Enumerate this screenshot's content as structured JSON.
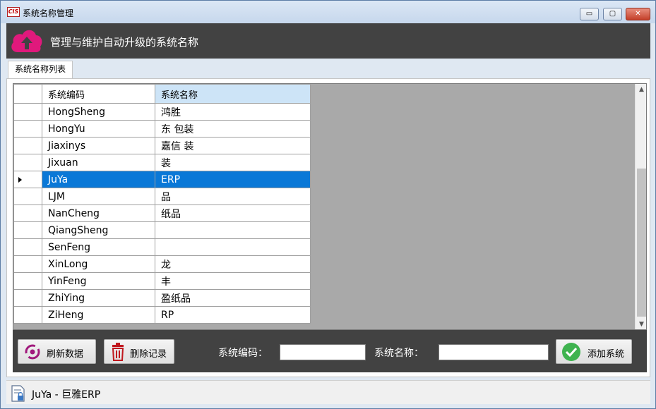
{
  "window": {
    "title": "系统名称管理",
    "app_icon_text": "CIS",
    "controls": {
      "minimize": "▭",
      "maximize": "▢",
      "close": "✕"
    }
  },
  "header": {
    "title": "管理与维护自动升级的系统名称",
    "icon": "cloud-upload-icon",
    "icon_color": "#e0197c"
  },
  "tabs": [
    {
      "label": "系统名称列表",
      "active": true
    }
  ],
  "grid": {
    "columns": [
      "系统编码",
      "系统名称"
    ],
    "selected_index": 4,
    "rows": [
      {
        "code": "HongSheng",
        "name": "鸿胜"
      },
      {
        "code": "HongYu",
        "name": "东  包装"
      },
      {
        "code": "Jiaxinys",
        "name": "嘉信  装"
      },
      {
        "code": "Jixuan",
        "name": "  装"
      },
      {
        "code": "JuYa",
        "name": "  ERP"
      },
      {
        "code": "LJM",
        "name": "  品"
      },
      {
        "code": "NanCheng",
        "name": "  纸品"
      },
      {
        "code": "QiangSheng",
        "name": "  "
      },
      {
        "code": "SenFeng",
        "name": "  "
      },
      {
        "code": "XinLong",
        "name": "  龙"
      },
      {
        "code": "YinFeng",
        "name": "  丰"
      },
      {
        "code": "ZhiYing",
        "name": "  盈纸品"
      },
      {
        "code": "ZiHeng",
        "name": "  RP"
      }
    ],
    "selection_color": "#0a78d7",
    "background_color": "#a9a9a9"
  },
  "toolbar": {
    "refresh_label": "刷新数据",
    "delete_label": "删除记录",
    "code_label": "系统编码：",
    "code_value": "",
    "name_label": "系统名称：",
    "name_value": "",
    "add_label": "添加系统",
    "icons": {
      "refresh": "refresh-icon",
      "delete": "trash-icon",
      "add": "check-circle-icon"
    }
  },
  "status": {
    "text": "JuYa - 巨雅ERP",
    "icon": "document-lock-icon"
  }
}
